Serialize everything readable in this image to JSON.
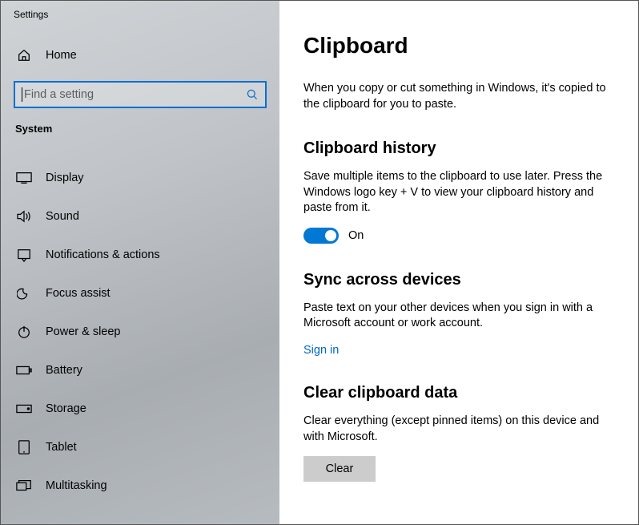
{
  "window": {
    "title": "Settings"
  },
  "sidebar": {
    "home": "Home",
    "search_placeholder": "Find a setting",
    "category": "System",
    "items": [
      {
        "id": "display",
        "label": "Display"
      },
      {
        "id": "sound",
        "label": "Sound"
      },
      {
        "id": "notifications",
        "label": "Notifications & actions"
      },
      {
        "id": "focus-assist",
        "label": "Focus assist"
      },
      {
        "id": "power-sleep",
        "label": "Power & sleep"
      },
      {
        "id": "battery",
        "label": "Battery"
      },
      {
        "id": "storage",
        "label": "Storage"
      },
      {
        "id": "tablet",
        "label": "Tablet"
      },
      {
        "id": "multitasking",
        "label": "Multitasking"
      }
    ]
  },
  "main": {
    "title": "Clipboard",
    "intro": "When you copy or cut something in Windows, it's copied to the clipboard for you to paste.",
    "history": {
      "heading": "Clipboard history",
      "desc": "Save multiple items to the clipboard to use later. Press the Windows logo key + V to view your clipboard history and paste from it.",
      "toggle_state": "On"
    },
    "sync": {
      "heading": "Sync across devices",
      "desc": "Paste text on your other devices when you sign in with a Microsoft account or work account.",
      "signin": "Sign in"
    },
    "clear": {
      "heading": "Clear clipboard data",
      "desc": "Clear everything (except pinned items) on this device and with Microsoft.",
      "button": "Clear"
    }
  }
}
